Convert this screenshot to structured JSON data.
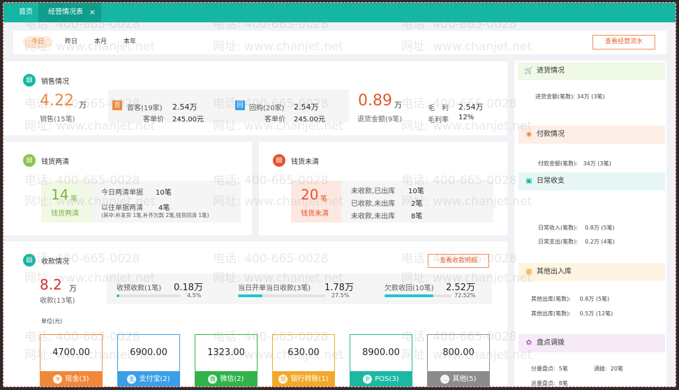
{
  "tabs": {
    "home": "首页",
    "active": "经营情况表",
    "close": "×"
  },
  "date_filter": {
    "today": "今日",
    "yesterday": "昨日",
    "month": "本月",
    "year": "本年",
    "flow_button": "查看经营流水"
  },
  "sales": {
    "title": "销售情况",
    "amount": "4.22",
    "amount_unit": "万",
    "count_label": "销售(15笔)",
    "first_tag": "首",
    "first_label": "首客(19家)",
    "first_value": "2.54万",
    "first_avg_label": "客单价",
    "first_avg_value": "245.00元",
    "repeat_tag": "回",
    "repeat_label": "回购(20家)",
    "repeat_value": "2.54万",
    "repeat_avg_label": "客单价",
    "repeat_avg_value": "245.00元",
    "return_amount": "0.89",
    "return_unit": "万",
    "return_label": "退货金额(9笔)",
    "gross_label": "毛　利",
    "gross_value": "2.54万",
    "margin_label": "毛利率",
    "margin_value": "12%"
  },
  "clear": {
    "title": "钱货两清",
    "count": "14",
    "unit": "笔",
    "label": "钱货两清",
    "row1_label": "今日两清单据",
    "row1_value": "10笔",
    "row2_label": "以往单据两清",
    "row2_value": "4笔",
    "row2_note": "(其中:补发货 1笔,补齐欠款 2笔,钱货同清 1笔)"
  },
  "unclear": {
    "title": "钱货未清",
    "count": "20",
    "unit": "笔",
    "label": "钱货未清",
    "rows": [
      {
        "label": "未收款,已出库",
        "value": "10笔"
      },
      {
        "label": "已收款,未出库",
        "value": "2笔"
      },
      {
        "label": "未收款,未出库",
        "value": "8笔"
      }
    ]
  },
  "collection": {
    "title": "收款情况",
    "detail_button": "查看收款明细",
    "amount": "8.2",
    "amount_unit": "万",
    "count_label": "收款(13笔)",
    "metrics": [
      {
        "label": "收预收款(1笔)",
        "value": "0.18万",
        "percent_text": "4.5%",
        "fraction": 0.045
      },
      {
        "label": "当日开单当日收款(3笔)",
        "value": "1.78万",
        "percent_text": "27.5%",
        "fraction": 0.275
      },
      {
        "label": "欠款收回(10笔)",
        "value": "2.52万",
        "percent_text": "72.52%",
        "fraction": 0.7252
      }
    ],
    "unit_label": "单位(元)",
    "methods": [
      {
        "amount": "4700.00",
        "label": "现金(3)",
        "color": "#f0883a",
        "icon": "¥"
      },
      {
        "amount": "6900.00",
        "label": "支付宝(2)",
        "color": "#3a9ee8",
        "icon": "支"
      },
      {
        "amount": "1323.00",
        "label": "微信(2)",
        "color": "#2fb34a",
        "icon": "微"
      },
      {
        "amount": "630.00",
        "label": "银行转账(1)",
        "color": "#f0a92a",
        "icon": "银"
      },
      {
        "amount": "8900.00",
        "label": "POS(3)",
        "color": "#1bb8a3",
        "icon": "P"
      },
      {
        "amount": "800.00",
        "label": "其他(5)",
        "color": "#8c8c8c",
        "icon": "…"
      }
    ]
  },
  "sidebar": {
    "purchase": {
      "title": "进货情况",
      "row1": "进货金额(笔数):",
      "row1_value": "34万 (3笔)"
    },
    "payment": {
      "title": "付款情况",
      "row1": "付款金额(笔数):",
      "row1_value": "34万 (3笔)"
    },
    "daily": {
      "title": "日常收支",
      "row1": "日常收入(笔数):",
      "row1_value": "0.8万 (5笔)",
      "row2": "日常支出(笔数):",
      "row2_value": "0.2万 (4笔)"
    },
    "other_io": {
      "title": "其他出入库",
      "row1": "其他出库(笔数):",
      "row1_value": "0.8万 (5笔)",
      "row2": "其他出库(笔数):",
      "row2_value": "0.5万 (12笔)"
    },
    "inventory": {
      "title": "盘点调拨",
      "row1": "分量盘点:",
      "row1_value": "5笔",
      "row1b": "调拨:",
      "row1b_value": "20笔",
      "row2": "总量盘点:",
      "row2_value": "8笔"
    }
  },
  "watermark": {
    "phone": "电话: 400-665-0028",
    "site": "网址: www.chanjet.net"
  },
  "colors": {
    "brand": "#15b6a3",
    "accent_orange": "#f28b54",
    "danger_red": "#d62a2a",
    "progress": "#27c2cf"
  }
}
